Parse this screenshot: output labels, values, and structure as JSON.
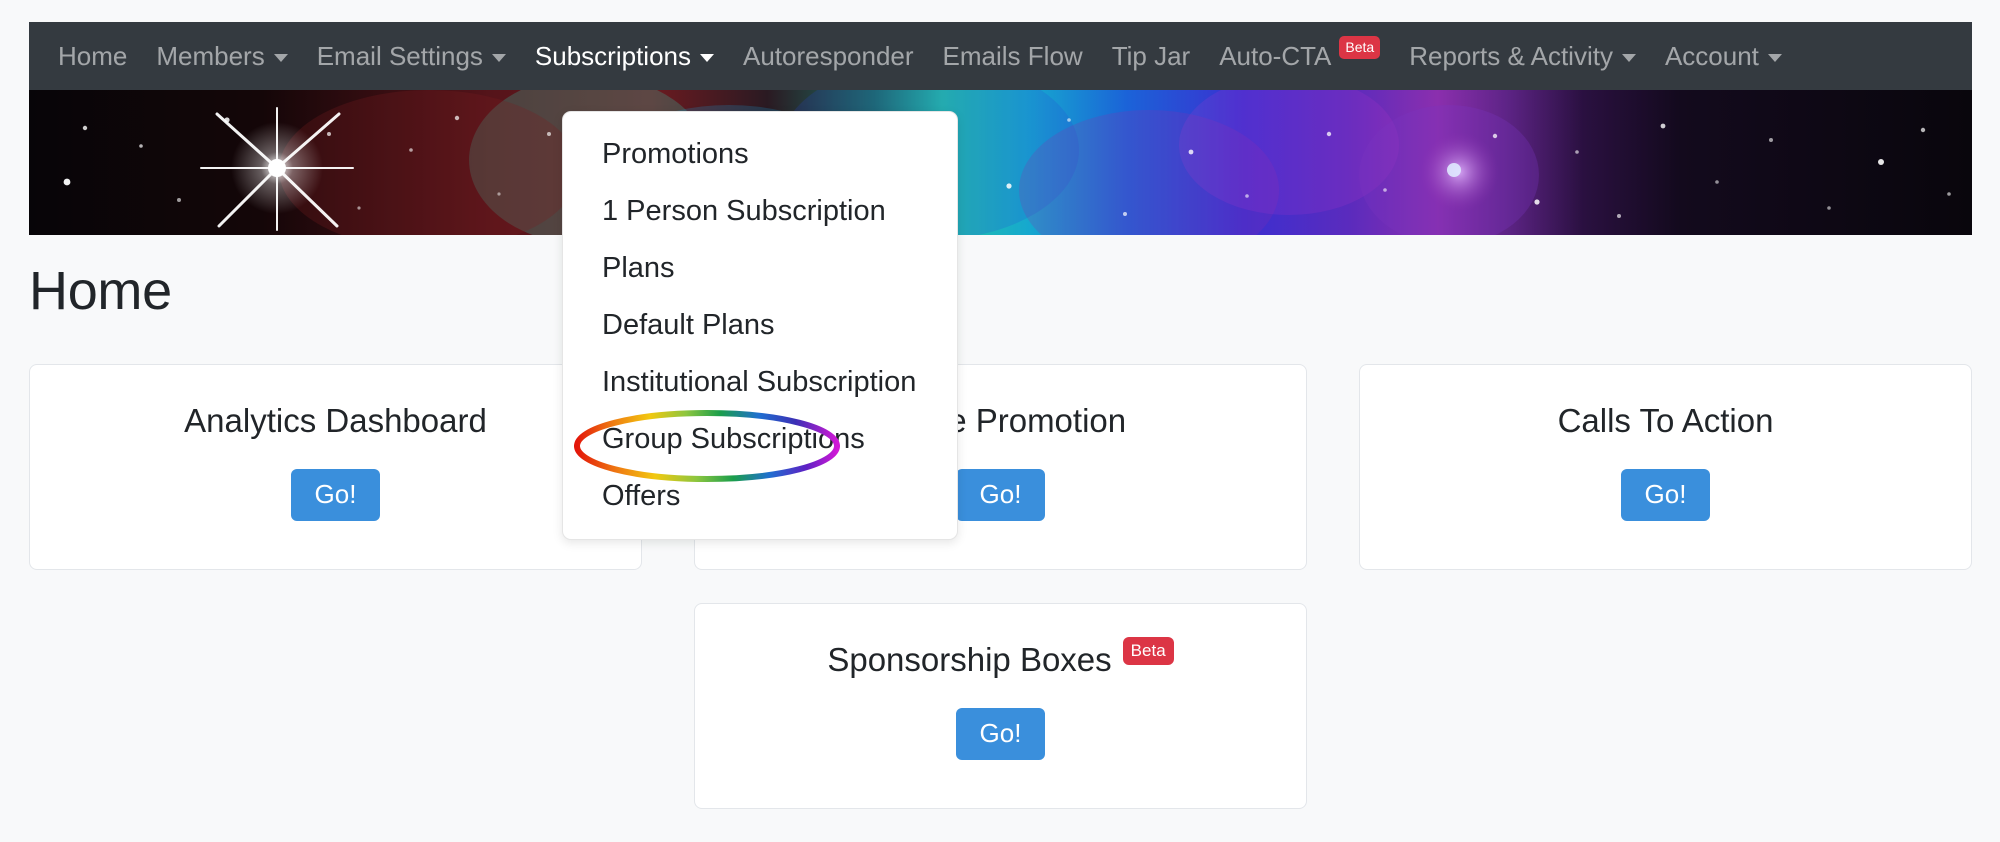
{
  "navbar": {
    "items": [
      {
        "label": "Home",
        "has_caret": false,
        "active": false,
        "badge": null
      },
      {
        "label": "Members",
        "has_caret": true,
        "active": false,
        "badge": null
      },
      {
        "label": "Email Settings",
        "has_caret": true,
        "active": false,
        "badge": null
      },
      {
        "label": "Subscriptions",
        "has_caret": true,
        "active": true,
        "badge": null
      },
      {
        "label": "Autoresponder",
        "has_caret": false,
        "active": false,
        "badge": null
      },
      {
        "label": "Emails Flow",
        "has_caret": false,
        "active": false,
        "badge": null
      },
      {
        "label": "Tip Jar",
        "has_caret": false,
        "active": false,
        "badge": null
      },
      {
        "label": "Auto-CTA",
        "has_caret": false,
        "active": false,
        "badge": "Beta"
      },
      {
        "label": "Reports & Activity",
        "has_caret": true,
        "active": false,
        "badge": null
      },
      {
        "label": "Account",
        "has_caret": true,
        "active": false,
        "badge": null
      }
    ],
    "background_color": "#343a40",
    "link_color": "#8d9499",
    "active_link_color": "#ffffff",
    "badge_color": "#dc3545"
  },
  "banner": {
    "alt": "deep space nebula banner image"
  },
  "page": {
    "title": "Home",
    "background_color": "#f8f9fa"
  },
  "dropdown": {
    "parent": "Subscriptions",
    "open": true,
    "items": [
      {
        "label": "Promotions"
      },
      {
        "label": "1 Person Subscription"
      },
      {
        "label": "Plans"
      },
      {
        "label": "Default Plans"
      },
      {
        "label": "Institutional Subscription"
      },
      {
        "label": "Group Subscriptions"
      },
      {
        "label": "Offers"
      }
    ]
  },
  "annotation": {
    "type": "rainbow-ellipse",
    "target": "Group Subscriptions",
    "colors": [
      "#e3170a",
      "#ef7d12",
      "#f2c80f",
      "#8cc63f",
      "#1b9e4b",
      "#1f6fd0",
      "#3b2fb5",
      "#7a1fc0",
      "#d018d6"
    ]
  },
  "cards": [
    {
      "title": "Analytics Dashboard",
      "badge": null,
      "button_label": "Go!"
    },
    {
      "title": "Article Promotion",
      "badge": null,
      "button_label": "Go!"
    },
    {
      "title": "Calls To Action",
      "badge": null,
      "button_label": "Go!"
    },
    {
      "title": "Sponsorship Boxes",
      "badge": "Beta",
      "button_label": "Go!"
    }
  ],
  "colors": {
    "button_primary": "#3a8fdc",
    "card_background": "#ffffff",
    "card_border": "#e3e6ea",
    "text_primary": "#212529"
  }
}
